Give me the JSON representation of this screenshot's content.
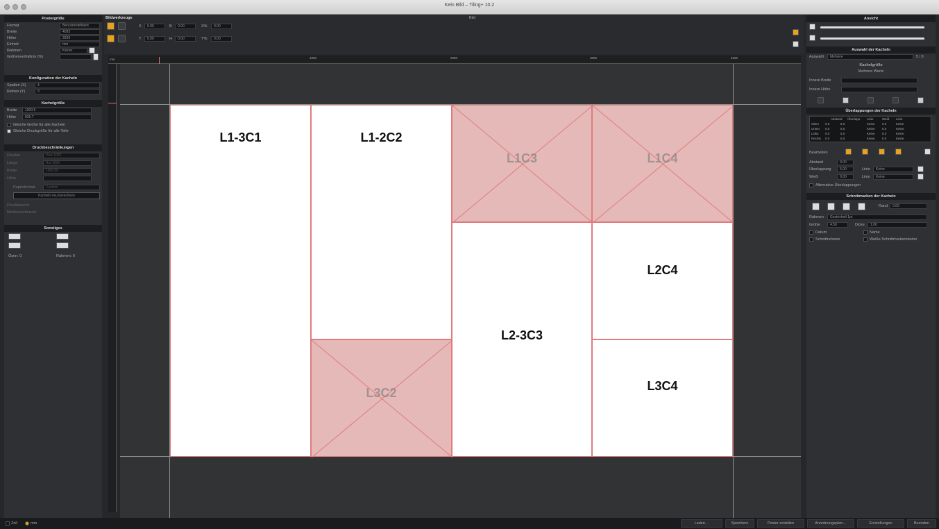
{
  "window": {
    "title": "Kein Bild – Tiling+ 10.2"
  },
  "left": {
    "poster": {
      "header": "Postergröße",
      "rows": [
        {
          "label": "Format",
          "value": "Benutzerdefiniert"
        },
        {
          "label": "Breite",
          "value": "4093"
        },
        {
          "label": "Höhe",
          "value": "2509"
        },
        {
          "label": "Einheit",
          "value": "mm"
        },
        {
          "label": "Rahmen",
          "value": "Keiner"
        },
        {
          "label": "Größenverhältnis (%)",
          "value": ""
        }
      ]
    },
    "config": {
      "header": "Konfiguration der Kacheln",
      "rows": [
        {
          "label": "Spalten (X)",
          "value": "4"
        },
        {
          "label": "Reihen (Y)",
          "value": "3"
        }
      ]
    },
    "tilesize": {
      "header": "Kachelgröße",
      "rows": [
        {
          "label": "Breite",
          "value": "1000.5"
        },
        {
          "label": "Höhe",
          "value": "836.7"
        }
      ],
      "check1": "Gleiche Größe für alle Kacheln",
      "check2": "Gleiche Druckgröße für alle Teile"
    },
    "print": {
      "header": "Druckbeschränkungen",
      "rows": [
        {
          "label": "Drucker",
          "value": "Plus 1000"
        },
        {
          "label": "Länge",
          "value": "Rol 1000"
        },
        {
          "label": "Breite",
          "value": "1000.00"
        },
        {
          "label": "Höhe",
          "value": ""
        }
      ],
      "paper_label": "Papierformat",
      "paper_value": "Custom",
      "button": "Kacheln neu berechnen",
      "extra1": "Druckbereich",
      "extra2": "Medienverbrauch"
    },
    "misc": {
      "header": "Sonstiges",
      "osen_label": "Ösen: 0",
      "rahmen_label": "Rahmen: 0"
    }
  },
  "toolbar": {
    "header": "Bildwerkzeuge",
    "x_label": "X",
    "x_value": "0.00",
    "y_label": "Y",
    "y_value": "0.00",
    "b_label": "B",
    "b_value": "0.00",
    "h_label": "H",
    "h_value": "0.00",
    "xp_label": "X%",
    "xp_value": "0.00",
    "yp_label": "Y%",
    "yp_value": "0.00",
    "bild_label": "Bild"
  },
  "ruler": {
    "unit": "mm",
    "marks": [
      "1000",
      "2000",
      "3000",
      "4000"
    ]
  },
  "tiles": [
    {
      "label": "L1-3C1",
      "disabled": false
    },
    {
      "label": "L1-2C2",
      "disabled": false
    },
    {
      "label": "L3C2",
      "disabled": true
    },
    {
      "label": "L1C3",
      "disabled": true
    },
    {
      "label": "L2-3C3",
      "disabled": false
    },
    {
      "label": "L1C4",
      "disabled": true
    },
    {
      "label": "L2C4",
      "disabled": false
    },
    {
      "label": "L3C4",
      "disabled": false
    }
  ],
  "right": {
    "view": {
      "header": "Ansicht"
    },
    "selection": {
      "header": "Auswahl der Kacheln",
      "label": "Auswahl",
      "value": "Mehrere",
      "count": "5 / 8"
    },
    "tilesize": {
      "header": "Kachelgröße",
      "sub": "Mehrere Werte",
      "w_label": "Innere Breite",
      "h_label": "Innere Höhe"
    },
    "overlap": {
      "header": "Überlappungen der Kacheln",
      "columns": [
        "",
        "Abstand",
        "Überlapp.",
        "Linie",
        "Weiß",
        "Linie"
      ],
      "rows": [
        [
          "Oben",
          "0.0",
          "5.0",
          "Keine",
          "0.0",
          "Keine"
        ],
        [
          "Unten",
          "0.0",
          "5.0",
          "Keine",
          "0.0",
          "Keine"
        ],
        [
          "Links",
          "0.0",
          "5.0",
          "Keine",
          "0.0",
          "Keine"
        ],
        [
          "Rechts",
          "0.0",
          "5.0",
          "Keine",
          "0.0",
          "Keine"
        ]
      ],
      "edit_label": "Bearbeiten",
      "abstand_label": "Abstand",
      "abstand_value": "0.00",
      "ueber_label": "Überlappung",
      "ueber_value": "5.00",
      "weiss_label": "Weiß",
      "weiss_value": "0.00",
      "linie_label": "Linie",
      "linie_value": "Keine",
      "alt_label": "Alternative Überlappungen"
    },
    "cut": {
      "header": "Schnittmarken der Kacheln",
      "rand_label": "Rand",
      "rand_value": "0.00",
      "rahmen_label": "Rahmen",
      "rahmen_value": "Gestrichelt 1pt",
      "groesse_label": "Größe",
      "groesse_value": "4.50",
      "dicke_label": "Dicke",
      "dicke_value": "1.00",
      "c1": "Datum",
      "c2": "Name",
      "c3": "Schnittrahmen",
      "c4": "Weiße Schnittmarkenränder"
    }
  },
  "bottom": {
    "zoll": "Zoll",
    "mm": "mm",
    "buttons": [
      "Laden…",
      "Speichern",
      "Poster erstellen",
      "Anordnungsplan…",
      "Einstellungen",
      "Beenden"
    ]
  },
  "colors": {
    "accent": "#e8a21b",
    "tile_line": "#e07b7b",
    "disabled_tile": "#e4b9b8"
  }
}
